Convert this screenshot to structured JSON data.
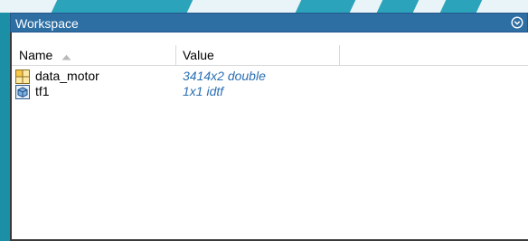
{
  "panel": {
    "title": "Workspace",
    "menu_icon": "chevron-down-circle-icon"
  },
  "table": {
    "columns": {
      "name": "Name",
      "value": "Value"
    },
    "sort_icon": "sort-ascending-icon",
    "rows": [
      {
        "name": "data_motor",
        "value": "3414x2 double",
        "icon": "matrix-icon"
      },
      {
        "name": "tf1",
        "value": "1x1 idtf",
        "icon": "object-icon"
      }
    ]
  },
  "colors": {
    "titlebar": "#2d6ea3",
    "value_text": "#2a6fb3",
    "background": "#1b8fa6"
  }
}
